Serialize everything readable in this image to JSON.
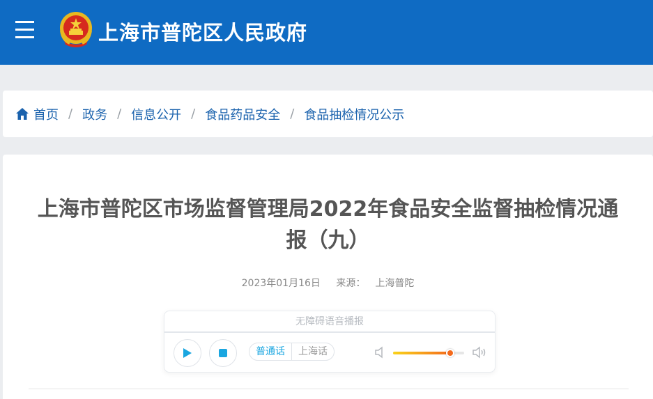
{
  "header": {
    "title": "上海市普陀区人民政府",
    "background_color": "#0f6bc3"
  },
  "breadcrumb": {
    "items": [
      {
        "label": "首页",
        "icon": "home-icon"
      },
      {
        "label": "政务"
      },
      {
        "label": "信息公开"
      },
      {
        "label": "食品药品安全"
      },
      {
        "label": "食品抽检情况公示"
      }
    ],
    "separator": "/"
  },
  "article": {
    "title": "上海市普陀区市场监督管理局2022年食品安全监督抽检情况通报（九）",
    "date": "2023年01月16日",
    "source_label": "来源：",
    "source": "上海普陀"
  },
  "player": {
    "header": "无障碍语音播报",
    "play_icon": "play-icon",
    "stop_icon": "stop-icon",
    "lang_options": [
      "普通话",
      "上海话"
    ],
    "selected_lang": "普通话",
    "volume": 0.8,
    "accent_color": "#1aa6e0"
  }
}
